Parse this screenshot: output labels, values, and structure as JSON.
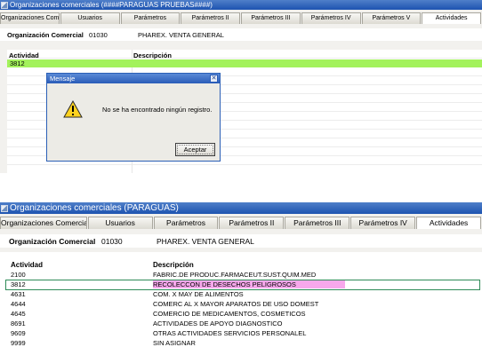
{
  "top": {
    "title": "Organizaciones comerciales (####PARAGUAS PRUEBAS####)",
    "tabs": [
      "Organizaciones Comerciales",
      "Usuarios",
      "Parámetros",
      "Parámetros II",
      "Parámetros III",
      "Parámetros IV",
      "Parámetros V",
      "Actividades"
    ],
    "active_tab": "Actividades",
    "org_label": "Organización Comercial",
    "org_code": "01030",
    "org_name": "PHAREX.  VENTA GENERAL",
    "col_actividad": "Actividad",
    "col_descripcion": "Descripción",
    "selected_activity": "3812",
    "selected_color": "#a3f25c",
    "dialog": {
      "title": "Mensaje",
      "message": "No se ha encontrado ningún registro.",
      "button": "Aceptar",
      "icon": "warning-icon"
    }
  },
  "bottom": {
    "title": "Organizaciones comerciales (PARAGUAS)",
    "tabs": [
      "Organizaciones Comerciales",
      "Usuarios",
      "Parámetros",
      "Parámetros II",
      "Parámetros III",
      "Parámetros IV",
      "Actividades"
    ],
    "active_tab": "Actividades",
    "org_label": "Organización Comercial",
    "org_code": "01030",
    "org_name": "PHAREX.  VENTA GENERAL",
    "col_actividad": "Actividad",
    "col_descripcion": "Descripción",
    "highlight_color": "#f7a8ec",
    "rows": [
      {
        "code": "2100",
        "desc": "FABRIC.DE PRODUC.FARMACEUT.SUST.QUIM.MED"
      },
      {
        "code": "3812",
        "desc": "RECOLECCON DE DESECHOS  PELIGROSOS"
      },
      {
        "code": "4631",
        "desc": "COM. X MAY DE ALIMENTOS"
      },
      {
        "code": "4644",
        "desc": "COMERC AL X MAYOR APARATOS DE USO DOMEST"
      },
      {
        "code": "4645",
        "desc": "COMERCIO DE MEDICAMENTOS, COSMETICOS"
      },
      {
        "code": "8691",
        "desc": "ACTIVIDADES DE APOYO DIAGNOSTICO"
      },
      {
        "code": "9609",
        "desc": "OTRAS ACTIVIDADES SERVICIOS PERSONALEL"
      },
      {
        "code": "9999",
        "desc": "SIN ASIGNAR"
      }
    ]
  }
}
